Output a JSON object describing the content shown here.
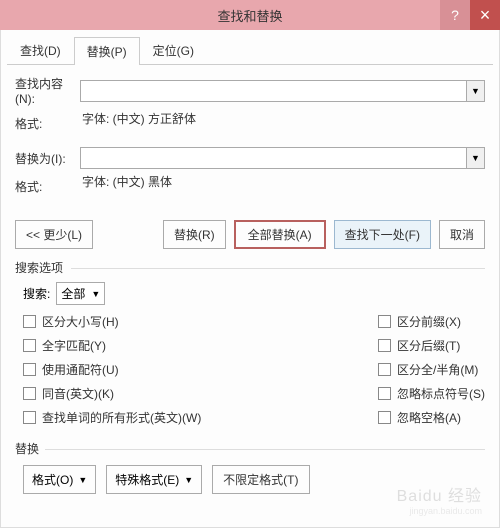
{
  "titlebar": {
    "title": "查找和替换",
    "help": "?",
    "close": "×"
  },
  "tabs": {
    "find": "查找(D)",
    "replace": "替换(P)",
    "goto": "定位(G)"
  },
  "form": {
    "find_label": "查找内容(N):",
    "find_value": "",
    "find_format_label": "格式:",
    "find_format_value": "字体: (中文) 方正舒体",
    "replace_label": "替换为(I):",
    "replace_value": "",
    "replace_format_label": "格式:",
    "replace_format_value": "字体: (中文) 黑体"
  },
  "buttons": {
    "less": "<< 更少(L)",
    "replace": "替换(R)",
    "replace_all": "全部替换(A)",
    "find_next": "查找下一处(F)",
    "cancel": "取消"
  },
  "options": {
    "legend": "搜索选项",
    "search_label": "搜索:",
    "search_value": "全部",
    "left": [
      "区分大小写(H)",
      "全字匹配(Y)",
      "使用通配符(U)",
      "同音(英文)(K)",
      "查找单词的所有形式(英文)(W)"
    ],
    "right": [
      "区分前缀(X)",
      "区分后缀(T)",
      "区分全/半角(M)",
      "忽略标点符号(S)",
      "忽略空格(A)"
    ]
  },
  "replace_section": {
    "legend": "替换",
    "format_btn": "格式(O)",
    "special_btn": "特殊格式(E)",
    "nolimit_btn": "不限定格式(T)"
  },
  "watermark": {
    "top": "Baidu 经验",
    "bot": "jingyan.baidu.com"
  }
}
